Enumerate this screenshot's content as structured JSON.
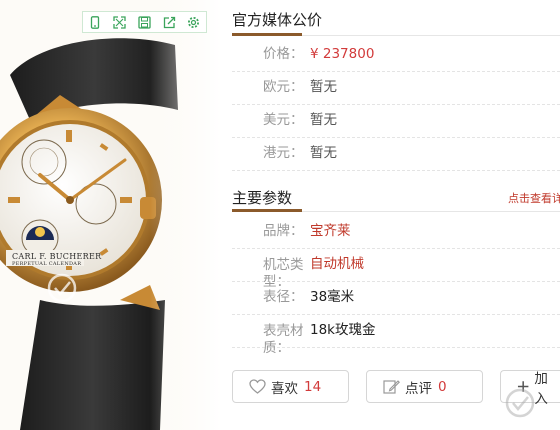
{
  "toolbar": {
    "icons": [
      "phone-icon",
      "expand-icon",
      "save-icon",
      "share-icon",
      "settings-icon"
    ]
  },
  "photo": {
    "watch_brand": "CARL F. BUCHERER",
    "watch_sub": "PERPETUAL CALENDAR"
  },
  "media_price": {
    "title": "官方媒体公价",
    "rows": [
      {
        "label": "价格：",
        "value": "¥ 237800"
      },
      {
        "label": "欧元：",
        "value": "暂无"
      },
      {
        "label": "美元：",
        "value": "暂无"
      },
      {
        "label": "港元：",
        "value": "暂无"
      }
    ]
  },
  "params": {
    "title": "主要参数",
    "more_link": "点击查看详",
    "rows": [
      {
        "label": "品牌：",
        "value": "宝齐莱"
      },
      {
        "label": "机芯类型：",
        "value": "自动机械"
      },
      {
        "label": "表径：",
        "value": "38毫米"
      },
      {
        "label": "表壳材质：",
        "value": "18k玫瑰金"
      }
    ]
  },
  "actions": {
    "like_label": "喜欢",
    "like_count": "14",
    "review_label": "点评",
    "review_count": "0",
    "add_label": "加入"
  },
  "colors": {
    "accent_brown": "#8b5a2b",
    "price_red": "#d23b3b",
    "toolbar_green": "#3aa45b"
  }
}
